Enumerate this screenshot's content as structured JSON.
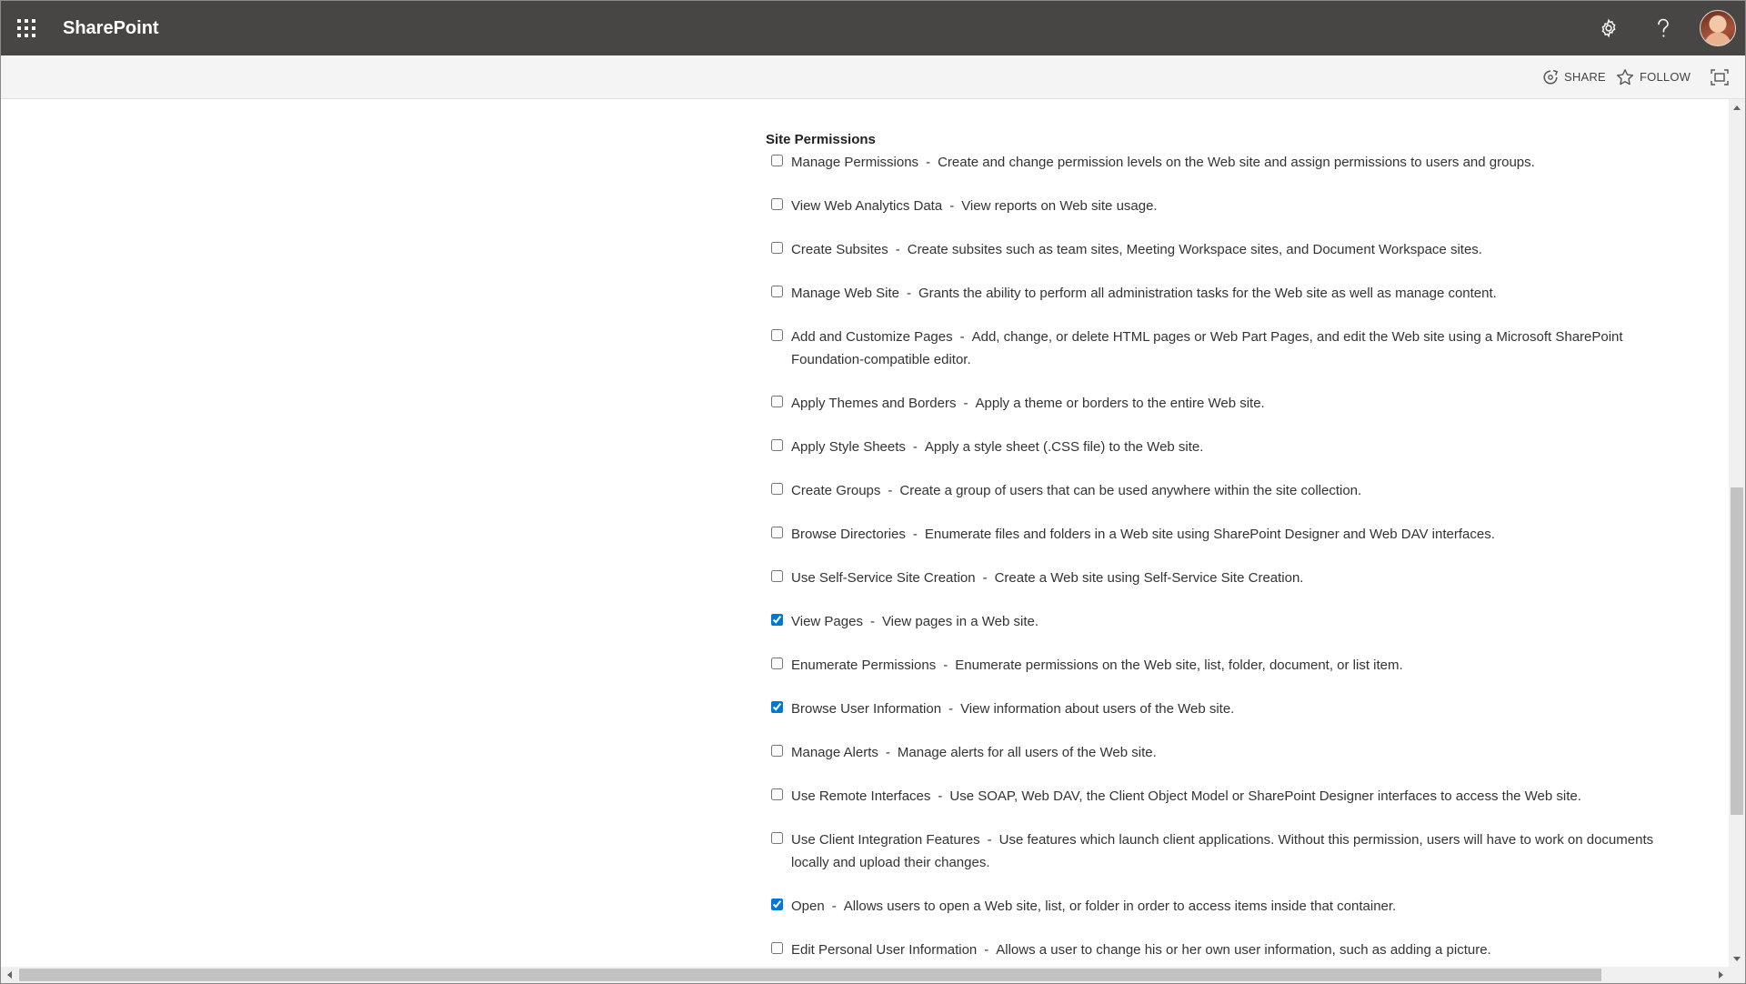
{
  "suite_bar": {
    "brand": "SharePoint",
    "icons": [
      "app-launcher-icon",
      "settings-gear-icon",
      "help-question-icon",
      "user-avatar"
    ]
  },
  "command_bar": {
    "share_label": "SHARE",
    "follow_label": "FOLLOW"
  },
  "section": {
    "title": "Site Permissions",
    "separator": "-",
    "items": [
      {
        "name": "Manage Permissions",
        "description": "Create and change permission levels on the Web site and assign permissions to users and groups.",
        "checked": false
      },
      {
        "name": "View Web Analytics Data",
        "description": "View reports on Web site usage.",
        "checked": false
      },
      {
        "name": "Create Subsites",
        "description": "Create subsites such as team sites, Meeting Workspace sites, and Document Workspace sites.",
        "checked": false
      },
      {
        "name": "Manage Web Site",
        "description": "Grants the ability to perform all administration tasks for the Web site as well as manage content.",
        "checked": false
      },
      {
        "name": "Add and Customize Pages",
        "description": "Add, change, or delete HTML pages or Web Part Pages, and edit the Web site using a Microsoft SharePoint Foundation-compatible editor.",
        "checked": false
      },
      {
        "name": "Apply Themes and Borders",
        "description": "Apply a theme or borders to the entire Web site.",
        "checked": false
      },
      {
        "name": "Apply Style Sheets",
        "description": "Apply a style sheet (.CSS file) to the Web site.",
        "checked": false
      },
      {
        "name": "Create Groups",
        "description": "Create a group of users that can be used anywhere within the site collection.",
        "checked": false
      },
      {
        "name": "Browse Directories",
        "description": "Enumerate files and folders in a Web site using SharePoint Designer and Web DAV interfaces.",
        "checked": false
      },
      {
        "name": "Use Self-Service Site Creation",
        "description": "Create a Web site using Self-Service Site Creation.",
        "checked": false
      },
      {
        "name": "View Pages",
        "description": "View pages in a Web site.",
        "checked": true
      },
      {
        "name": "Enumerate Permissions",
        "description": "Enumerate permissions on the Web site, list, folder, document, or list item.",
        "checked": false
      },
      {
        "name": "Browse User Information",
        "description": "View information about users of the Web site.",
        "checked": true
      },
      {
        "name": "Manage Alerts",
        "description": "Manage alerts for all users of the Web site.",
        "checked": false
      },
      {
        "name": "Use Remote Interfaces",
        "description": "Use SOAP, Web DAV, the Client Object Model or SharePoint Designer interfaces to access the Web site.",
        "checked": false
      },
      {
        "name": "Use Client Integration Features",
        "description": "Use features which launch client applications. Without this permission, users will have to work on documents locally and upload their changes.",
        "checked": false
      },
      {
        "name": "Open",
        "description": "Allows users to open a Web site, list, or folder in order to access items inside that container.",
        "checked": true
      },
      {
        "name": "Edit Personal User Information",
        "description": "Allows a user to change his or her own user information, such as adding a picture.",
        "checked": false
      }
    ]
  },
  "colors": {
    "suite_bar_bg": "#484644",
    "command_bar_bg": "#f4f4f4",
    "checkbox_accent": "#0078d4"
  }
}
